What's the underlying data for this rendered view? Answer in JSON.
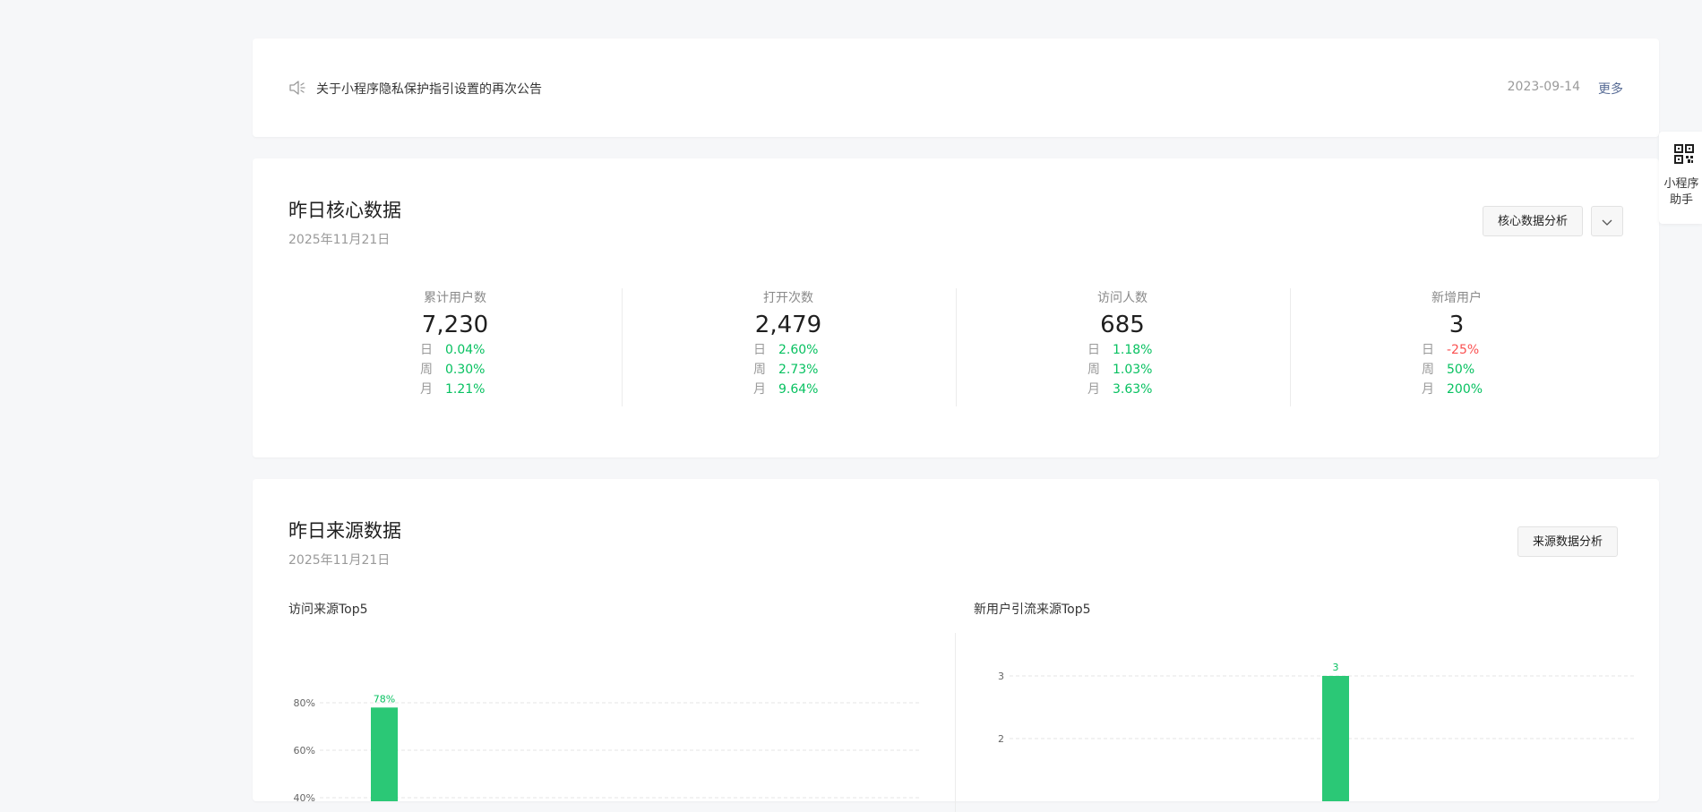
{
  "notice": {
    "text": "关于小程序隐私保护指引设置的再次公告",
    "date": "2023-09-14",
    "more": "更多"
  },
  "core": {
    "title": "昨日核心数据",
    "date": "2025年11月21日",
    "analysis_button": "核心数据分析",
    "metrics": [
      {
        "label": "累计用户数",
        "value": "7,230",
        "rows": [
          {
            "k": "日",
            "v": "0.04%"
          },
          {
            "k": "周",
            "v": "0.30%"
          },
          {
            "k": "月",
            "v": "1.21%"
          }
        ]
      },
      {
        "label": "打开次数",
        "value": "2,479",
        "rows": [
          {
            "k": "日",
            "v": "2.60%"
          },
          {
            "k": "周",
            "v": "2.73%"
          },
          {
            "k": "月",
            "v": "9.64%"
          }
        ]
      },
      {
        "label": "访问人数",
        "value": "685",
        "rows": [
          {
            "k": "日",
            "v": "1.18%"
          },
          {
            "k": "周",
            "v": "1.03%"
          },
          {
            "k": "月",
            "v": "3.63%"
          }
        ]
      },
      {
        "label": "新增用户",
        "value": "3",
        "rows": [
          {
            "k": "日",
            "v": "-25%"
          },
          {
            "k": "周",
            "v": "50%"
          },
          {
            "k": "月",
            "v": "200%"
          }
        ]
      }
    ]
  },
  "source": {
    "title": "昨日来源数据",
    "date": "2025年11月21日",
    "analysis_button": "来源数据分析",
    "visit_chart_title": "访问来源Top5",
    "newuser_chart_title": "新用户引流来源Top5"
  },
  "side_helper": {
    "label_line1": "小程序",
    "label_line2": "助手"
  },
  "colors": {
    "accent_green": "#07c160",
    "bar_green": "#2bc876",
    "negative_red": "#fa5151",
    "link_blue": "#576b95"
  },
  "chart_data": [
    {
      "type": "bar",
      "title": "访问来源Top5",
      "yticks": [
        "40%",
        "60%",
        "80%"
      ],
      "ylim": [
        0,
        80
      ],
      "values": [
        78
      ],
      "value_labels": [
        "78%"
      ],
      "color": "#2bc876"
    },
    {
      "type": "bar",
      "title": "新用户引流来源Top5",
      "yticks": [
        "2",
        "3"
      ],
      "ylim": [
        0,
        3
      ],
      "values": [
        3
      ],
      "value_labels": [
        "3"
      ],
      "color": "#2bc876"
    }
  ]
}
